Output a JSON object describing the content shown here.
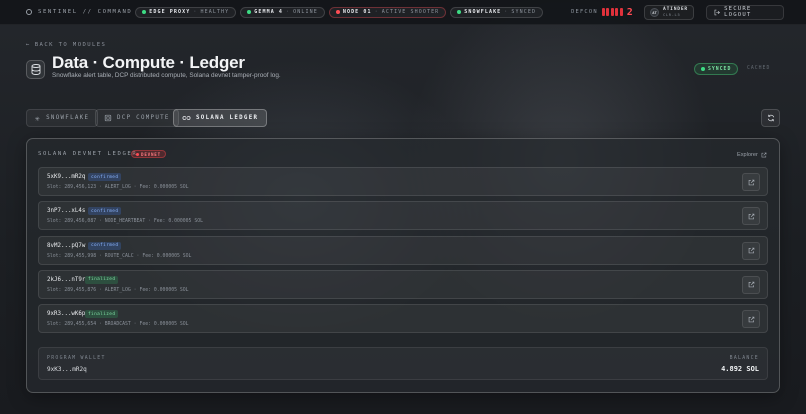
{
  "topbar": {
    "brand": "SENTINEL // COMMAND",
    "services": [
      {
        "name": "EDGE PROXY",
        "status": "HEALTHY",
        "color": "#3ddc84"
      },
      {
        "name": "GEMMA 4",
        "status": "ONLINE",
        "color": "#3ddc84"
      },
      {
        "name": "NODE 01",
        "status": "ACTIVE SHOOTER",
        "color": "#ff4d55"
      },
      {
        "name": "SNOWFLAKE",
        "status": "SYNCED",
        "color": "#3ddc84"
      }
    ],
    "defcon_label": "DEFCON",
    "defcon_level": "2",
    "user": {
      "initials": "AT",
      "name": "ATINDER",
      "role": "CLR-L5"
    },
    "logout_label": "SECURE LOGOUT"
  },
  "header": {
    "back_label": "BACK TO MODULES",
    "title": "Data · Compute · Ledger",
    "subtitle": "Snowflake alert table, DCP distributed compute, Solana devnet tamper-proof log.",
    "synced_label": "SYNCED",
    "cached_label": "CACHED"
  },
  "tabs": [
    {
      "label": "SNOWFLAKE",
      "icon": "snowflake-icon",
      "active": false
    },
    {
      "label": "DCP COMPUTE",
      "icon": "cpu-icon",
      "active": false
    },
    {
      "label": "SOLANA LEDGER",
      "icon": "link-icon",
      "active": true
    }
  ],
  "ledger": {
    "title": "SOLANA DEVNET LEDGER",
    "badge": "DEVNET",
    "explorer_label": "Explorer",
    "transactions": [
      {
        "hash": "5xK9...mR2q",
        "status": "confirmed",
        "slot": "Slot: 289,456,123",
        "type": "ALERT_LOG",
        "fee": "Fee: 0.000005 SOL"
      },
      {
        "hash": "3nP7...xL4s",
        "status": "confirmed",
        "slot": "Slot: 289,456,087",
        "type": "NODE_HEARTBEAT",
        "fee": "Fee: 0.000005 SOL"
      },
      {
        "hash": "8vM2...pQ7w",
        "status": "confirmed",
        "slot": "Slot: 289,455,998",
        "type": "ROUTE_CALC",
        "fee": "Fee: 0.000005 SOL"
      },
      {
        "hash": "2kJ6...nT9r",
        "status": "finalized",
        "slot": "Slot: 289,455,876",
        "type": "ALERT_LOG",
        "fee": "Fee: 0.000005 SOL"
      },
      {
        "hash": "9xR3...wK6p",
        "status": "finalized",
        "slot": "Slot: 289,455,654",
        "type": "BROADCAST",
        "fee": "Fee: 0.000005 SOL"
      }
    ],
    "wallet_label": "PROGRAM WALLET",
    "wallet_address": "9xK3...mR2q",
    "balance_label": "BALANCE",
    "balance_value": "4.892 SOL"
  }
}
